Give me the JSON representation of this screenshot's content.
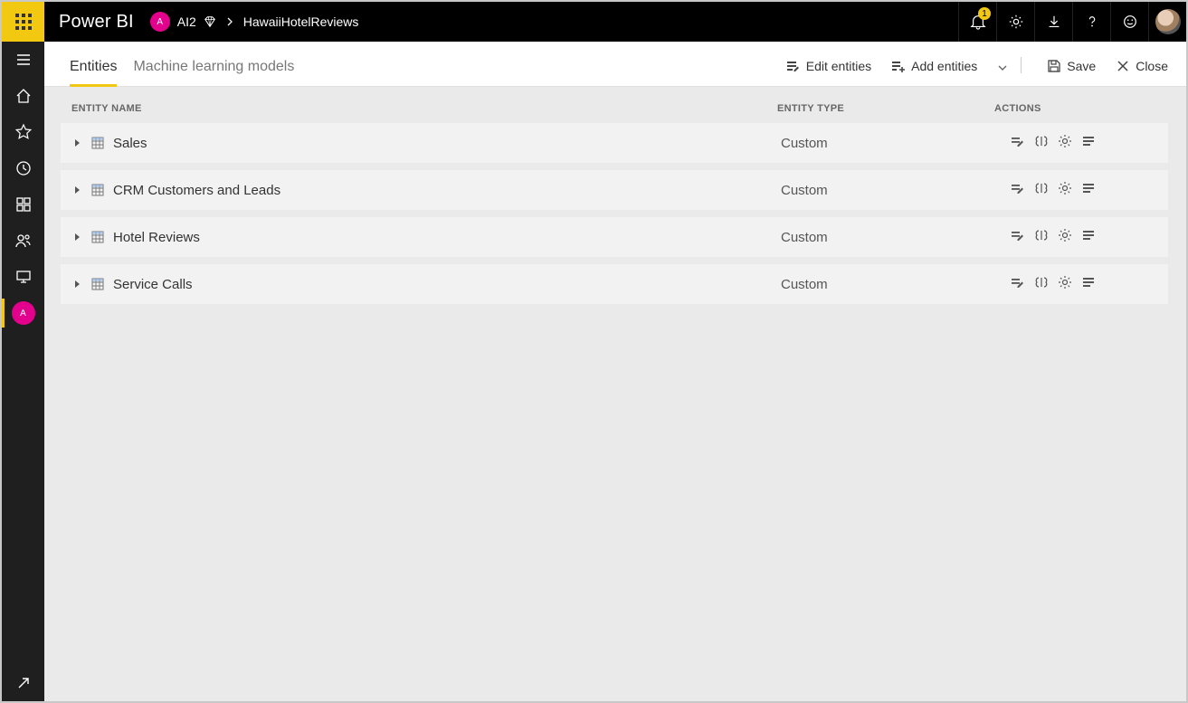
{
  "header": {
    "brand": "Power BI",
    "workspace_initial": "A",
    "workspace_name": "AI2",
    "breadcrumb": "HawaiiHotelReviews",
    "notification_count": "1"
  },
  "toolbar": {
    "tabs": [
      {
        "label": "Entities",
        "active": true
      },
      {
        "label": "Machine learning models",
        "active": false
      }
    ],
    "edit_label": "Edit entities",
    "add_label": "Add entities",
    "save_label": "Save",
    "close_label": "Close"
  },
  "grid": {
    "columns": {
      "name": "ENTITY NAME",
      "type": "ENTITY TYPE",
      "actions": "ACTIONS"
    },
    "rows": [
      {
        "name": "Sales",
        "type": "Custom"
      },
      {
        "name": "CRM Customers and Leads",
        "type": "Custom"
      },
      {
        "name": "Hotel Reviews",
        "type": "Custom"
      },
      {
        "name": "Service Calls",
        "type": "Custom"
      }
    ]
  },
  "leftrail": {
    "workspace_initial": "A"
  }
}
